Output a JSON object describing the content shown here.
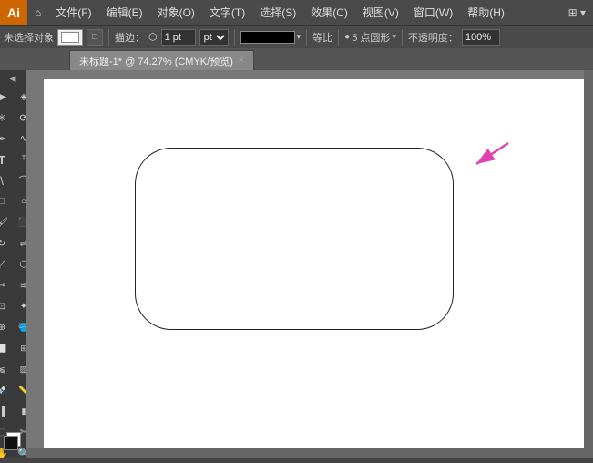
{
  "app": {
    "logo": "Ai",
    "logo_bg": "#cc6600"
  },
  "menu_bar": {
    "items": [
      "文件(F)",
      "编辑(E)",
      "对象(O)",
      "文字(T)",
      "选择(S)",
      "效果(C)",
      "视图(V)",
      "窗口(W)",
      "帮助(H)"
    ]
  },
  "toolbar": {
    "no_selection": "未选择对象",
    "stroke_label": "描边：",
    "stroke_value": "1 pt",
    "stroke_unit": "pt",
    "ratio_label": "等比",
    "points_label": "5 点圆形",
    "opacity_label": "不透明度：",
    "opacity_value": "100%"
  },
  "tab": {
    "title": "未标题-1* @ 74.27% (CMYK/预览)",
    "close": "×"
  },
  "tools": [
    {
      "icon": "▶",
      "name": "selection-tool"
    },
    {
      "icon": "⬦",
      "name": "direct-selection-tool"
    },
    {
      "icon": "✏",
      "name": "pen-tool"
    },
    {
      "icon": "T",
      "name": "type-tool"
    },
    {
      "icon": "\\",
      "name": "line-tool"
    },
    {
      "icon": "□",
      "name": "rect-tool"
    },
    {
      "icon": "⬡",
      "name": "poly-tool"
    },
    {
      "icon": "✂",
      "name": "scissors-tool"
    },
    {
      "icon": "↗",
      "name": "rotate-tool"
    },
    {
      "icon": "⬌",
      "name": "scale-tool"
    },
    {
      "icon": "⬛",
      "name": "shape-builder-tool"
    },
    {
      "icon": "✦",
      "name": "live-paint-tool"
    },
    {
      "icon": "💧",
      "name": "mesh-tool"
    },
    {
      "icon": "⬜",
      "name": "gradient-tool"
    },
    {
      "icon": "🖊",
      "name": "blob-brush-tool"
    },
    {
      "icon": "▬",
      "name": "chart-tool"
    },
    {
      "icon": "☞",
      "name": "artboard-tool"
    },
    {
      "icon": "🔍",
      "name": "zoom-tool"
    },
    {
      "icon": "✋",
      "name": "hand-tool"
    }
  ],
  "canvas": {
    "zoom": "74.27%",
    "color_mode": "CMYK/预览"
  },
  "shape": {
    "type": "rounded-rectangle",
    "border_radius": "40px",
    "stroke_color": "#222",
    "fill_color": "white"
  }
}
